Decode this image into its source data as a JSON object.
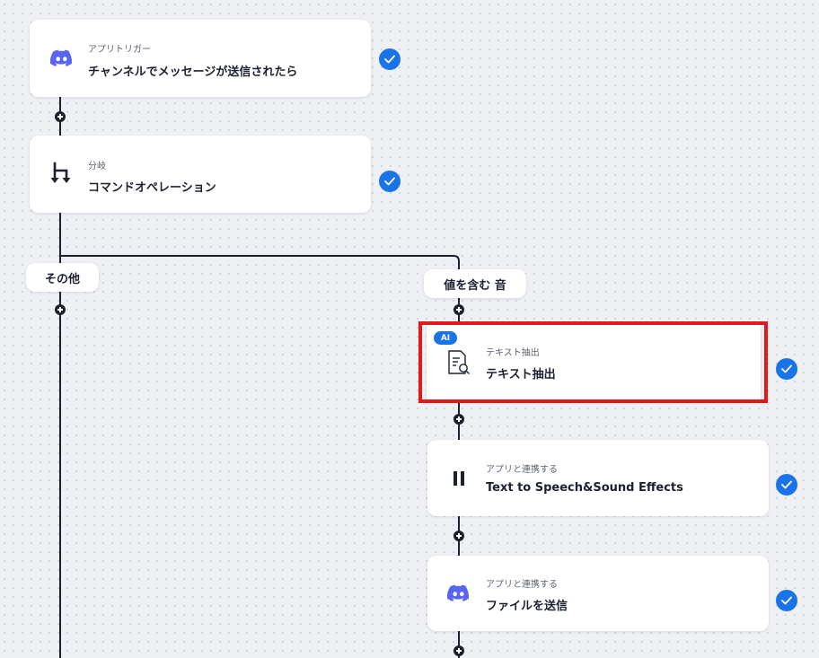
{
  "colors": {
    "accent": "#1a73e8",
    "highlight": "#e0191b",
    "discord": "#5865f2",
    "line": "#1c2130"
  },
  "steps": [
    {
      "subtitle": "アプリトリガー",
      "title": "チャンネルでメッセージが送信されたら",
      "icon": "discord-icon",
      "completed": true
    },
    {
      "subtitle": "分岐",
      "title": "コマンドオペレーション",
      "icon": "branch-icon",
      "completed": true
    }
  ],
  "branches": {
    "left": {
      "label": "その他"
    },
    "right": {
      "label": "値を含む 音"
    }
  },
  "branch_steps": [
    {
      "badge": "AI",
      "subtitle": "テキスト抽出",
      "title": "テキスト抽出",
      "icon": "document-search-icon",
      "completed": true,
      "highlighted": true
    },
    {
      "subtitle": "アプリと連携する",
      "title": "Text to Speech&Sound Effects",
      "icon": "pause-bars-icon",
      "completed": true
    },
    {
      "subtitle": "アプリと連携する",
      "title": "ファイルを送信",
      "icon": "discord-icon",
      "completed": true
    }
  ]
}
